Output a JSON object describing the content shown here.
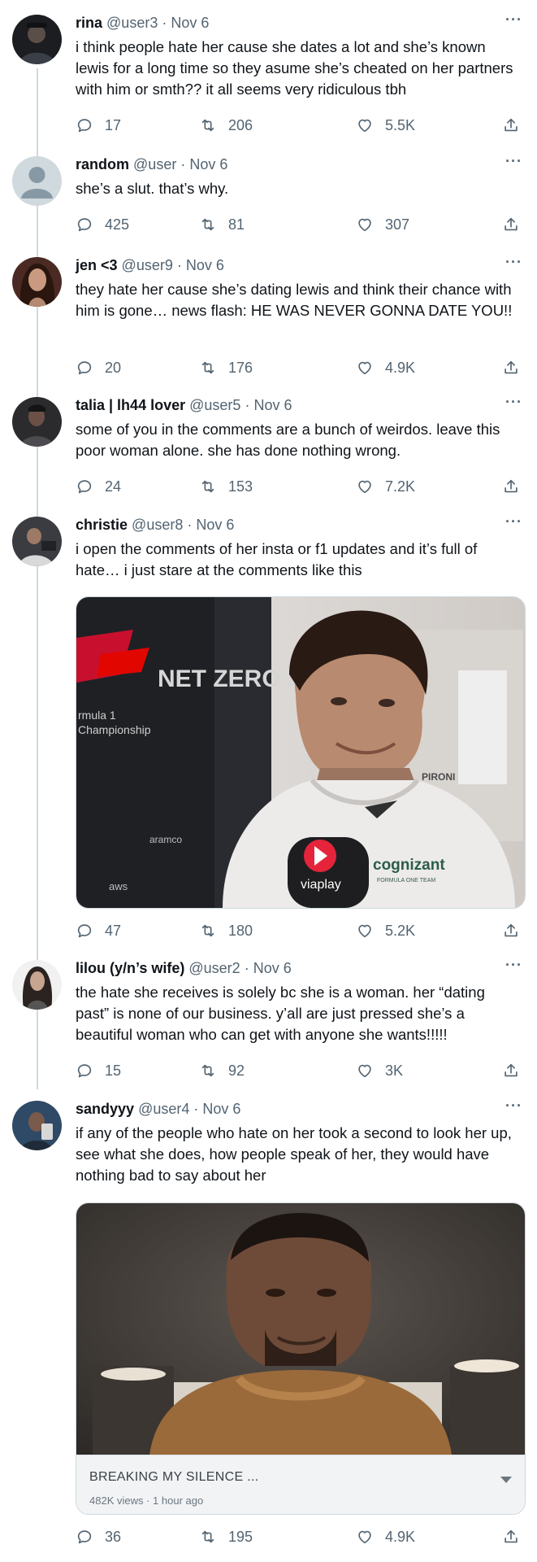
{
  "tweets": [
    {
      "name": "rina",
      "handle": "@user3",
      "date": "Nov 6",
      "text": "i think people hate her cause she dates a lot and she’s known lewis for a long time so they asume she’s cheated on her partners with him or smth?? it all seems very ridiculous tbh",
      "replies": "17",
      "retweets": "206",
      "likes": "5.5K"
    },
    {
      "name": "random",
      "handle": "@user",
      "date": "Nov 6",
      "text": "she’s a slut. that’s why.",
      "replies": "425",
      "retweets": "81",
      "likes": "307"
    },
    {
      "name": "jen <3",
      "handle": "@user9",
      "date": "Nov 6",
      "text": "they hate her cause she’s dating lewis and think their chance with him is gone… news flash: HE WAS NEVER GONNA DATE YOU!!",
      "replies": "20",
      "retweets": "176",
      "likes": "4.9K"
    },
    {
      "name": "talia | lh44 lover",
      "handle": "@user5",
      "date": "Nov 6",
      "text": "some of you in the comments are a bunch of weirdos. leave this poor woman alone. she has done nothing wrong.",
      "replies": "24",
      "retweets": "153",
      "likes": "7.2K"
    },
    {
      "name": "christie",
      "handle": "@user8",
      "date": "Nov 6",
      "text": "i open the comments of her insta or f1 updates and it’s full of hate… i just stare at the comments like this",
      "replies": "47",
      "retweets": "180",
      "likes": "5.2K",
      "media": {
        "backdrop_title": "NET ZERO 2030",
        "backdrop_sub1": "rmula 1",
        "backdrop_sub2": "Championship",
        "sponsor1": "aramco",
        "sponsor2": "aws",
        "shirt_brand": "cognizant",
        "shirt_team": "FORMULA ONE TEAM",
        "shirt_brand2": "PIRONI",
        "mic_brand": "viaplay"
      }
    },
    {
      "name": "lilou (y/n’s wife)",
      "handle": "@user2",
      "date": "Nov 6",
      "text": "the hate she receives is solely bc she is a woman. her “dating past” is none of our business. y’all are just pressed she’s a beautiful woman who can get with anyone she wants!!!!!",
      "replies": "15",
      "retweets": "92",
      "likes": "3K"
    },
    {
      "name": "sandyyy",
      "handle": "@user4",
      "date": "Nov 6",
      "text": "if any of the people who hate on her took a second to look her up, see what she does, how people speak of her, they would have nothing bad to say about her",
      "replies": "36",
      "retweets": "195",
      "likes": "4.9K",
      "card": {
        "title": "BREAKING MY SILENCE ...",
        "subtitle": "482K views · 1 hour ago"
      }
    }
  ],
  "separator": "·",
  "more_glyph": "···",
  "colors": {
    "text": "#0f1419",
    "muted": "#536471",
    "thread": "#cfd9de"
  }
}
